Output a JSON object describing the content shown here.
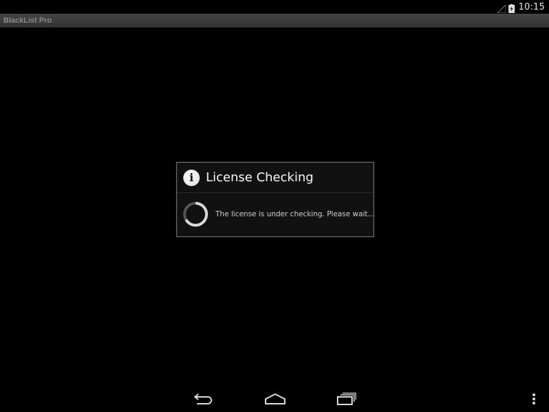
{
  "status_bar": {
    "time": "10:15",
    "icons": [
      "signal-icon",
      "battery-icon"
    ]
  },
  "title_bar": {
    "title": "BlackList Pro"
  },
  "dialog": {
    "icon": "info-icon",
    "title": "License Checking",
    "message": "The license is under checking. Please wait..."
  },
  "nav_bar": {
    "icons": [
      "back-icon",
      "home-icon",
      "recents-icon",
      "overflow-menu-icon"
    ]
  },
  "colors": {
    "background": "#000000",
    "title_bar": "#3a3a3a",
    "dialog_border": "#6d6d6d"
  }
}
